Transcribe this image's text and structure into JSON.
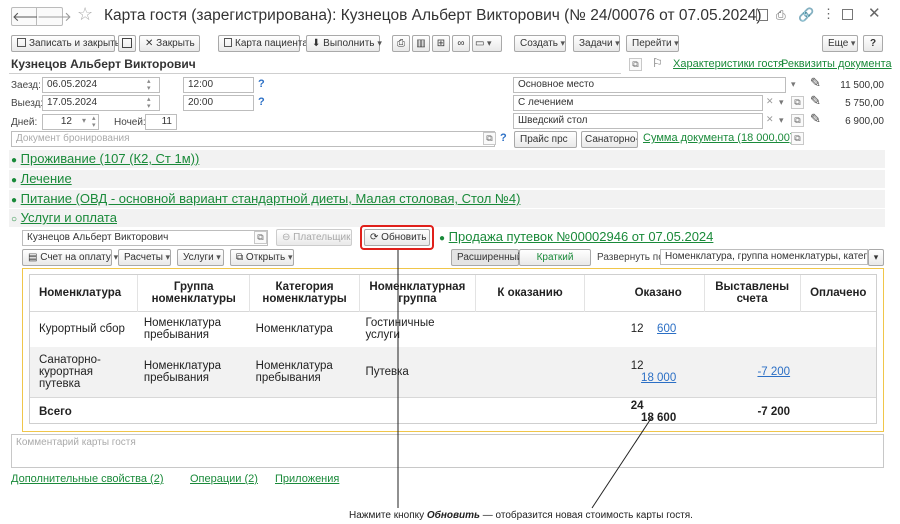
{
  "window": {
    "title": "Карта гостя (зарегистрирована): Кузнецов Альберт Викторович (№ 24/00076 от 07.05.2024)"
  },
  "toolbar": {
    "save_close": "Записать и закрыть",
    "close": "Закрыть",
    "patient_card": "Карта пациента",
    "execute": "Выполнить",
    "create": "Создать",
    "tasks": "Задачи",
    "goto": "Перейти",
    "more": "Еще",
    "help": "?"
  },
  "guest": {
    "name": "Кузнецов Альберт Викторович",
    "characteristics_link": "Характеристики гостя",
    "requisites_link": "Реквизиты документа"
  },
  "fields": {
    "arrival_label": "Заезд:",
    "arrival_date": "06.05.2024",
    "arrival_time": "12:00",
    "departure_label": "Выезд:",
    "departure_date": "17.05.2024",
    "departure_time": "20:00",
    "days_label": "Дней:",
    "days_value": "12",
    "nights_label": "Ночей:",
    "nights_value": "11",
    "booking_placeholder": "Документ бронирования",
    "question": "?"
  },
  "services_right": [
    {
      "name": "Основное место",
      "price": "11 500,00"
    },
    {
      "name": "С лечением",
      "price": "5 750,00"
    },
    {
      "name": "Шведский стол",
      "price": "6 900,00"
    }
  ],
  "price_buttons": {
    "price": "Прайс прс",
    "sanatorium": "Санаторно-к",
    "doc_sum": "Сумма документа (18 000,00)"
  },
  "sections": {
    "accommodation": "Проживание (107 (К2, Ст 1м))",
    "treatment": "Лечение",
    "nutrition": "Питание (ОВД - основной вариант стандартной диеты, Малая столовая, Стол №4)",
    "services_payment": "Услуги и оплата",
    "bullet_open": "●",
    "bullet_collapsed": "○"
  },
  "payment_row": {
    "payer_name": "Кузнецов Альберт Викторович",
    "payer_button": "Плательщик",
    "refresh_button": "Обновить",
    "sale_link": "Продажа путевок №00002946 от 07.05.2024"
  },
  "subtoolbar": {
    "invoice": "Счет на оплату",
    "settlements": "Расчеты",
    "services": "Услуги",
    "open": "Открыть",
    "extended": "Расширенный",
    "brief": "Краткий",
    "expand_label": "Развернуть по:",
    "expand_value": "Номенклатура, группа номенклатуры, категория н"
  },
  "table": {
    "headers": [
      "Номенклатура",
      "Группа номенклатуры",
      "Категория номенклатуры",
      "Номенклатурная группа",
      "К оказанию",
      "Оказано",
      "Выставлены счета",
      "Оплачено"
    ],
    "rows": [
      {
        "nomenclature": "Курортный сбор",
        "group": "Номенклатура пребывания",
        "category": "Номенклатура",
        "nom_group": "Гостиничные услуги",
        "to_render": "",
        "count": "12",
        "rendered": "600",
        "invoiced": "",
        "paid": ""
      },
      {
        "nomenclature": "Санаторно-курортная путевка",
        "group": "Номенклатура пребывания",
        "category": "Номенклатура пребывания",
        "nom_group": "Путевка",
        "to_render": "",
        "count": "12",
        "rendered": "18 000",
        "invoiced": "-7 200",
        "paid": ""
      }
    ],
    "total": {
      "label": "Всего",
      "count": "24",
      "rendered": "18 600",
      "invoiced": "-7 200"
    }
  },
  "comment_placeholder": "Комментарий карты гостя",
  "bottom_links": {
    "additional": "Дополнительные свойства (2)",
    "operations": "Операции (2)",
    "attachments": "Приложения"
  },
  "annotation": {
    "prefix": "Нажмите кнопку ",
    "emphasis": "Обновить",
    "suffix": " — отобразится новая стоимость карты гостя."
  }
}
